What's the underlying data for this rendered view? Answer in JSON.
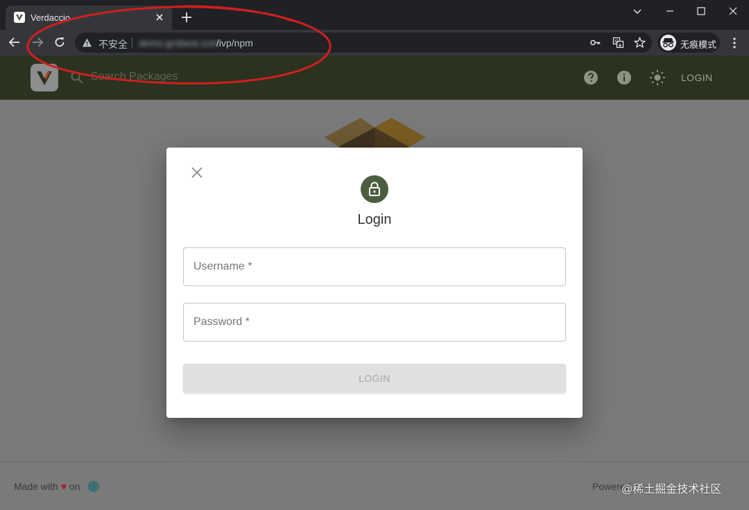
{
  "browser": {
    "tab": {
      "title": "Verdaccio",
      "favicon": "verdaccio-logo"
    },
    "window_controls": [
      "chevron-down-icon",
      "minimize-icon",
      "maximize-icon",
      "close-icon"
    ],
    "omnibox": {
      "security_label": "不安全",
      "host": "demo.grobest.com",
      "path": "/ivp/npm"
    },
    "toolbar_icons": [
      "key-icon",
      "translate-icon",
      "star-icon"
    ],
    "profile": {
      "label": "无痕模式",
      "icon": "incognito-icon"
    }
  },
  "header": {
    "search_placeholder": "Search Packages",
    "login_label": "LOGIN",
    "icons": [
      "help-icon",
      "info-icon",
      "theme-toggle-icon"
    ],
    "background_color": "#2b321f"
  },
  "modal": {
    "title": "Login",
    "username_label": "Username *",
    "password_label": "Password *",
    "submit_label": "LOGIN",
    "accent_color": "#4b5e40"
  },
  "footer": {
    "made_with_prefix": "Made with",
    "heart": "♥",
    "made_with_suffix": "on",
    "powered_text": "Powered by",
    "watermark": "@稀土掘金技术社区"
  }
}
